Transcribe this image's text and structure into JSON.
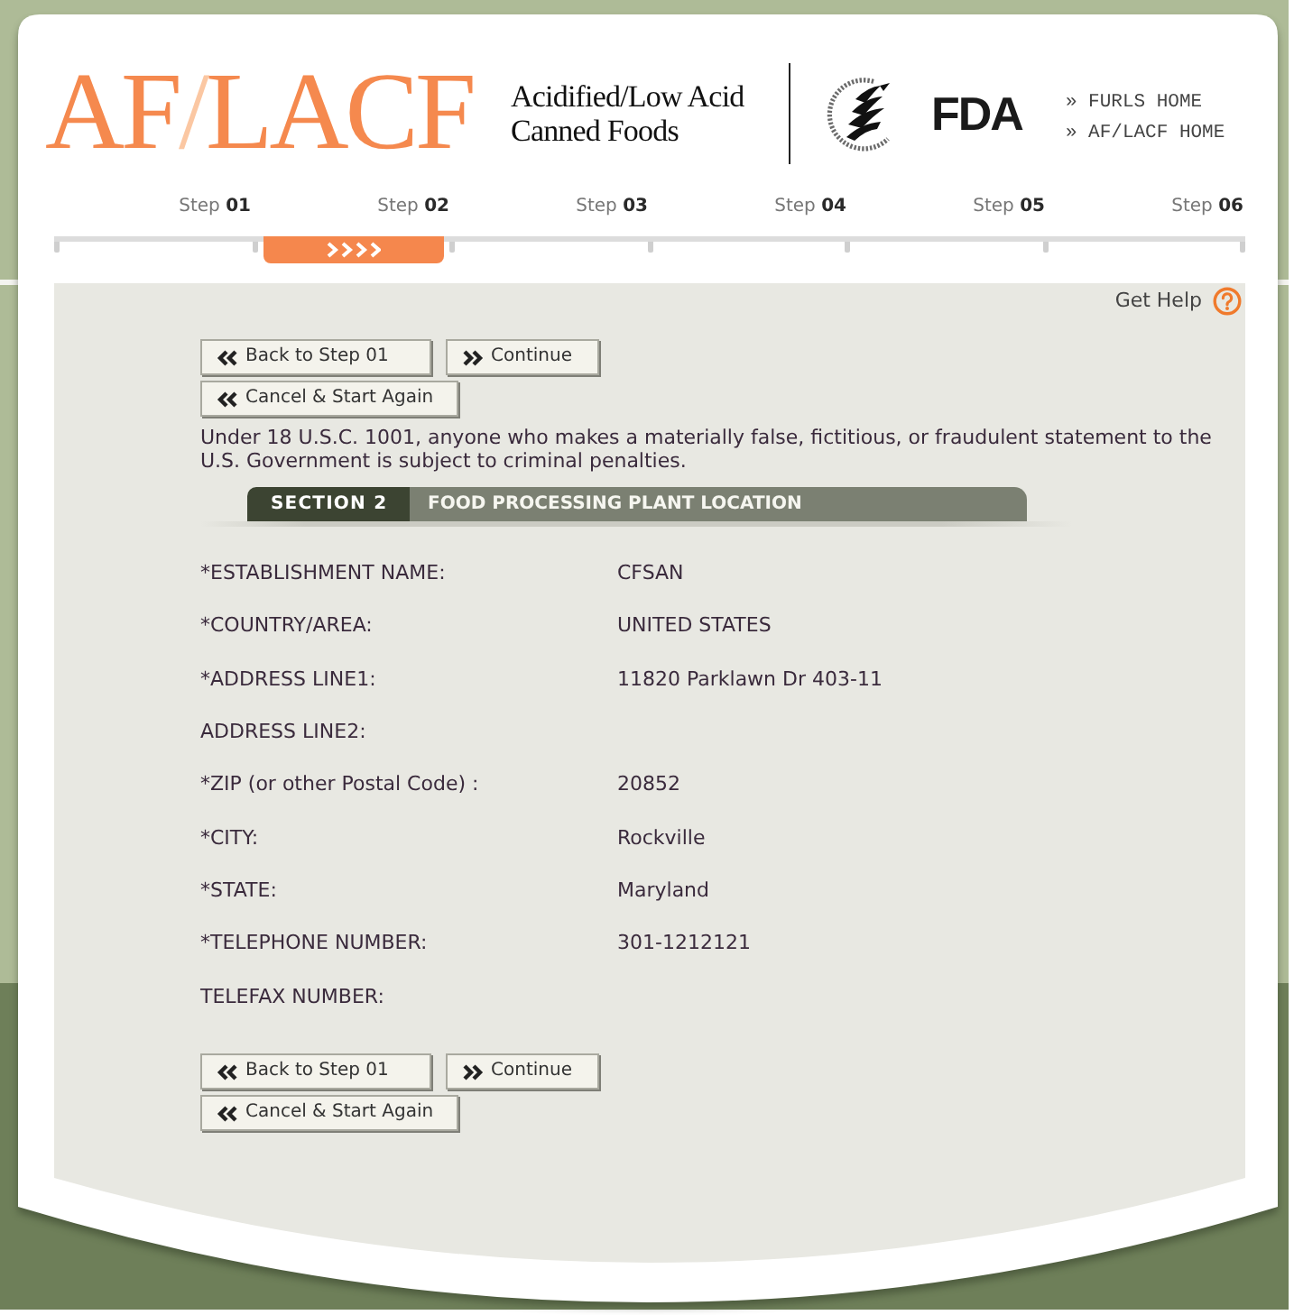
{
  "header": {
    "logo": [
      {
        "text": "AF",
        "color": "#f5894e"
      },
      {
        "text": "/",
        "color": "#fbc7a2"
      },
      {
        "text": "LACF",
        "color": "#f5894e"
      }
    ],
    "subtitle": "Acidified/Low Acid Canned Foods",
    "agency_logo": "FDA",
    "links": [
      "» FURLS HOME",
      "» AF/LACF HOME"
    ],
    "steps": [
      {
        "label": "Step **01**",
        "selected": false
      },
      {
        "label": "Step **02**",
        "selected": true
      },
      {
        "label": "Step **03**",
        "selected": false
      },
      {
        "label": "Step **04**",
        "selected": false
      },
      {
        "label": "Step **05**",
        "selected": false
      },
      {
        "label": "Step **06**",
        "selected": false
      }
    ]
  },
  "help": "Get Help",
  "top_buttons": [
    [
      {
        "label": "Back to Step 01",
        "kind": "back"
      },
      {
        "label": "Continue",
        "kind": "forward"
      }
    ],
    [
      {
        "label": "Cancel & Start Again",
        "kind": "back"
      }
    ]
  ],
  "notice": "Under 18 U.S.C. 1001, anyone who makes a materially false, fictitious, or fraudulent statement to the U.S. Government is subject to criminal penalties.",
  "section": {
    "number": "SECTION 2",
    "title": "FOOD PROCESSING PLANT LOCATION"
  },
  "fields": [
    {
      "label": "*ESTABLISHMENT NAME:",
      "value": "CFSAN"
    },
    {
      "label": "*COUNTRY/AREA:",
      "value": "UNITED STATES"
    },
    {
      "label": "*ADDRESS LINE1:",
      "value": "11820 Parklawn Dr 403-11"
    },
    {
      "label": "ADDRESS LINE2:"
    },
    {
      "label": "*ZIP (or other Postal Code) :",
      "value": "20852"
    },
    {
      "label": "*CITY:",
      "value": "Rockville"
    },
    {
      "label": "*STATE:",
      "value": "Maryland"
    },
    {
      "label": "*TELEPHONE NUMBER:",
      "value": "301-1212121"
    },
    {
      "label": "TELEFAX NUMBER:"
    }
  ],
  "bottom_buttons": [
    [
      {
        "label": "Back to Step 01",
        "kind": "back"
      },
      {
        "label": "Continue",
        "kind": "forward"
      }
    ],
    [
      {
        "label": "Cancel & Start Again",
        "kind": "back"
      }
    ]
  ]
}
